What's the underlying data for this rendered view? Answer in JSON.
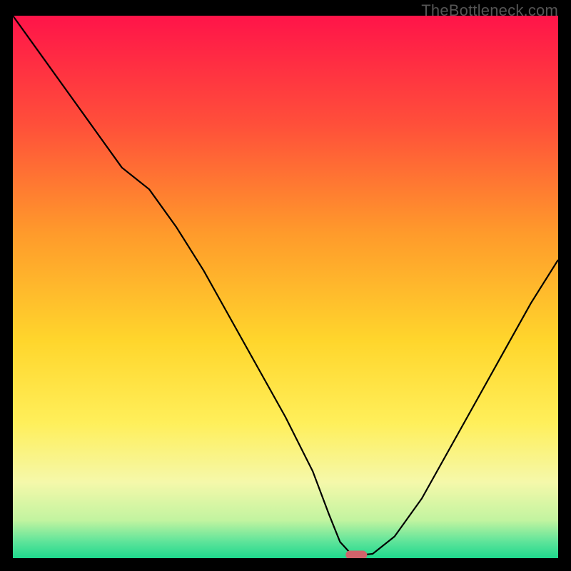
{
  "watermark": "TheBottleneck.com",
  "chart_data": {
    "type": "line",
    "title": "",
    "xlabel": "",
    "ylabel": "",
    "xlim": [
      0,
      100
    ],
    "ylim": [
      0,
      100
    ],
    "gradient_stops": [
      {
        "offset": 0,
        "color": "#ff1449"
      },
      {
        "offset": 20,
        "color": "#ff4f3a"
      },
      {
        "offset": 40,
        "color": "#ff9a2b"
      },
      {
        "offset": 60,
        "color": "#ffd62c"
      },
      {
        "offset": 75,
        "color": "#ffef5a"
      },
      {
        "offset": 86,
        "color": "#f5f8aa"
      },
      {
        "offset": 93,
        "color": "#c2f4a0"
      },
      {
        "offset": 97,
        "color": "#5de49a"
      },
      {
        "offset": 100,
        "color": "#1fd88d"
      }
    ],
    "series": [
      {
        "name": "bottleneck-curve",
        "x": [
          0,
          5,
          10,
          15,
          20,
          25,
          30,
          35,
          40,
          45,
          50,
          55,
          58,
          60,
          62,
          64,
          66,
          70,
          75,
          80,
          85,
          90,
          95,
          100
        ],
        "y": [
          100,
          93,
          86,
          79,
          72,
          68,
          61,
          53,
          44,
          35,
          26,
          16,
          8,
          3,
          0.8,
          0.6,
          0.8,
          4,
          11,
          20,
          29,
          38,
          47,
          55
        ]
      }
    ],
    "marker": {
      "x": 63,
      "y": 0.6,
      "color": "#d1636b"
    }
  }
}
